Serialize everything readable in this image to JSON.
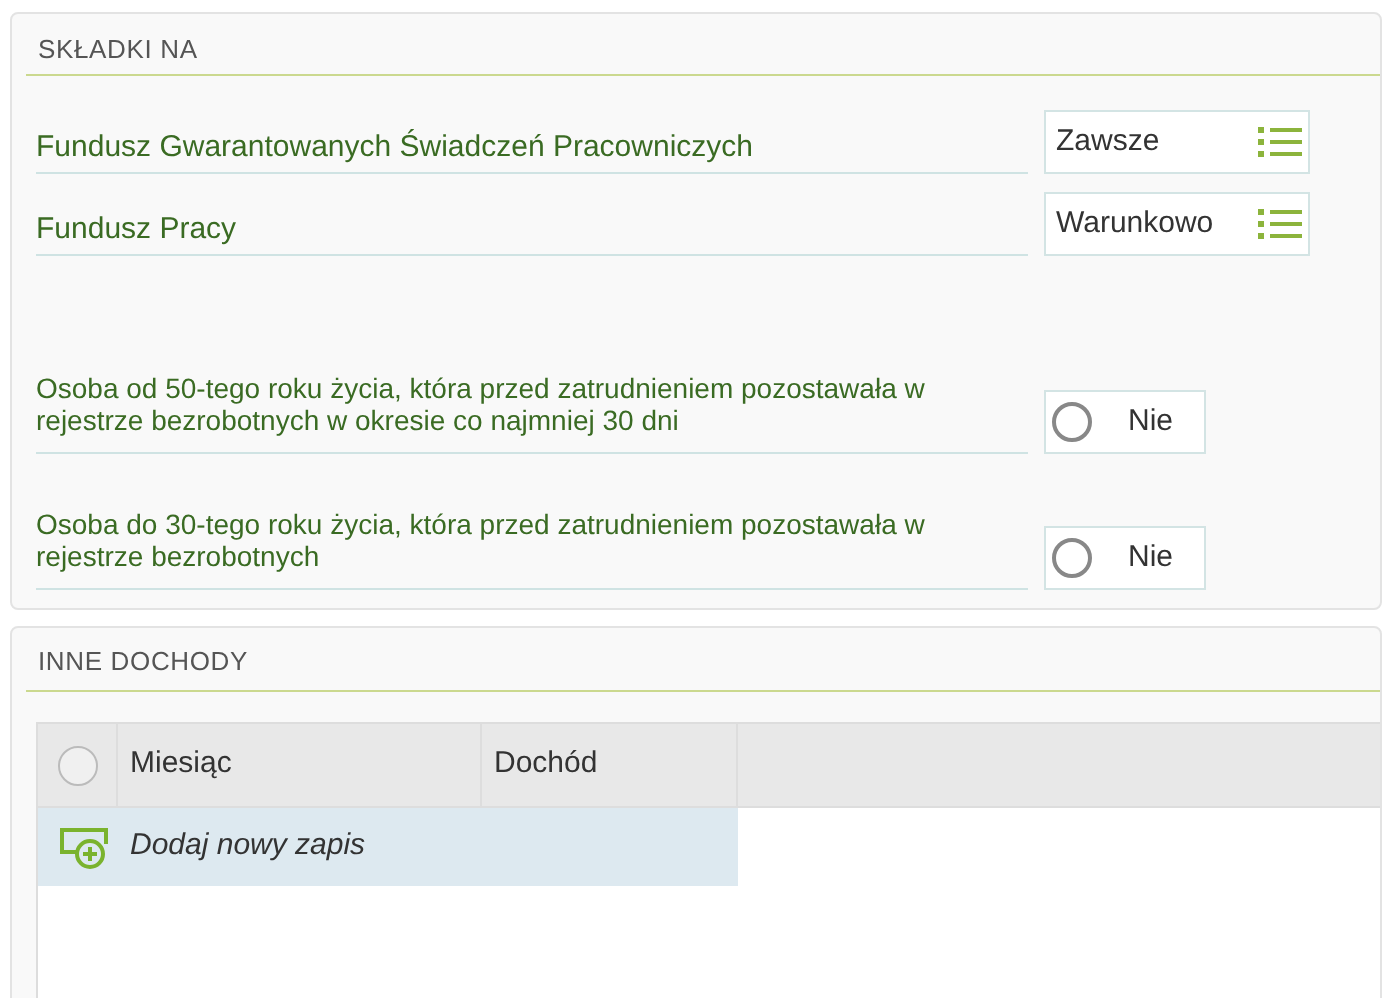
{
  "skladki": {
    "title": "SKŁADKI NA",
    "selects": [
      {
        "label": "Fundusz Gwarantowanych Świadczeń Pracowniczych",
        "value": "Zawsze"
      },
      {
        "label": "Fundusz Pracy",
        "value": "Warunkowo"
      }
    ],
    "toggles": [
      {
        "label": "Osoba od 50-tego roku życia, która przed zatrudnieniem pozostawała w rejestrze bezrobotnych w okresie co najmniej 30 dni",
        "value": "Nie",
        "checked": false
      },
      {
        "label": "Osoba do 30-tego roku życia, która przed zatrudnieniem pozostawała w rejestrze bezrobotnych",
        "value": "Nie",
        "checked": false
      }
    ]
  },
  "inne_dochody": {
    "title": "INNE DOCHODY",
    "select_all_checked": false,
    "columns": [
      "Miesiąc",
      "Dochód"
    ],
    "add_row": "Dodaj nowy zapis"
  }
}
